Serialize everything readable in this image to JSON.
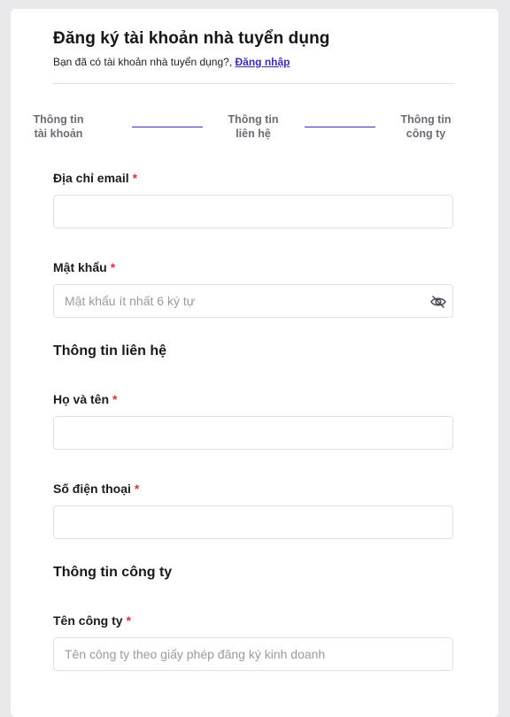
{
  "header": {
    "title": "Đăng ký tài khoản nhà tuyển dụng",
    "subtitle_text": "Bạn đã có tài khoản nhà tuyển dụng?,",
    "login_link": "Đăng nhập"
  },
  "steps": [
    {
      "line1": "Thông tin",
      "line2": "tài khoản"
    },
    {
      "line1": "Thông tin",
      "line2": "liên hệ"
    },
    {
      "line1": "Thông tin",
      "line2": "công ty"
    }
  ],
  "required_mark": "*",
  "account": {
    "email_label": "Địa chỉ email",
    "email_value": "",
    "password_label": "Mật khẩu",
    "password_placeholder": "Mật khẩu ít nhất 6 ký tự"
  },
  "contact": {
    "section_title": "Thông tin liên hệ",
    "name_label": "Họ và tên",
    "phone_label": "Số điện thoại"
  },
  "company": {
    "section_title": "Thông tin công ty",
    "company_name_label": "Tên công ty",
    "company_name_placeholder": "Tên công ty theo giấy phép đăng ký kinh doanh"
  },
  "colors": {
    "accent": "#3b2db5",
    "required": "#d9343a"
  },
  "icons": {
    "password_toggle": "eye-off-icon"
  }
}
